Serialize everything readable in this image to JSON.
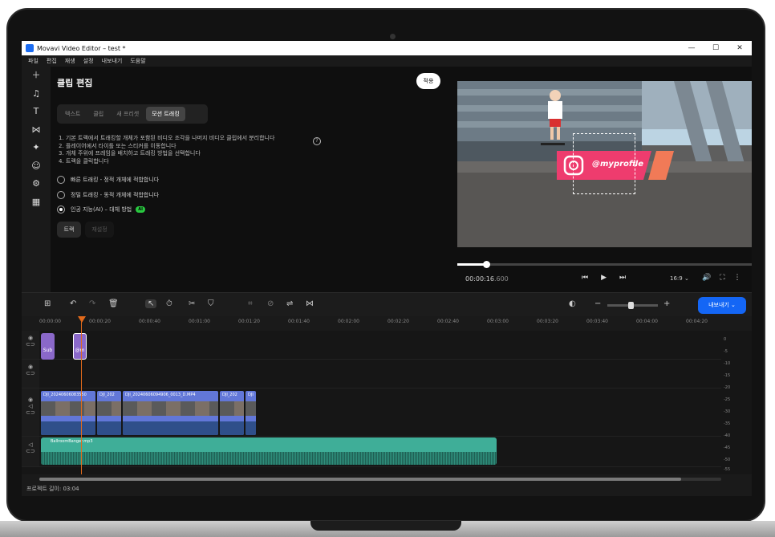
{
  "window": {
    "title": "Movavi Video Editor – test *",
    "controls": [
      "—",
      "☐",
      "✕"
    ]
  },
  "menu": [
    "파일",
    "편집",
    "재생",
    "설정",
    "내보내기",
    "도움말"
  ],
  "left_tools": [
    "plus-icon",
    "music-note-icon",
    "text-icon",
    "transition-icon",
    "effects-icon",
    "sticker-icon",
    "plugin-icon",
    "more-icon"
  ],
  "panel": {
    "title": "클립 편집",
    "apply": "적용",
    "tabs": [
      "텍스트",
      "클립",
      "새 프리셋",
      "모션 트래킹"
    ],
    "active_tab": 3,
    "steps": [
      "1. 기본 트랙에서 트래킹할 개체가 포함된 비디오 조각을 나머지 비디오 클립에서 분리합니다",
      "2. 플레이어에서 타이틀 또는 스티커를 이동합니다",
      "3. 개체 주위에 프레임을 배치하고 트래킹 방법을 선택합니다",
      "4. 트랙을 클릭합니다"
    ],
    "help": "?",
    "options": [
      {
        "label": "빠른 트래킹 - 정적 개체에 적합합니다",
        "selected": false
      },
      {
        "label": "정밀 트래킹 - 동적 개체에 적합합니다",
        "selected": false
      },
      {
        "label": "인공 지능(AI) – 대체 방법",
        "selected": true,
        "badge": "AI"
      }
    ],
    "track_button": "트랙",
    "reset_button": "재설정"
  },
  "preview": {
    "overlay_text": "@myprofile",
    "timecode": "00:00:16",
    "timecode_ms": ".600",
    "progress": 0.1,
    "aspect": "16:9",
    "aspect_arrow": "⌄",
    "controls": [
      "⏮",
      "▶",
      "⏭"
    ],
    "icons": [
      "🔊",
      "⛶",
      "⋮"
    ]
  },
  "toolbar": {
    "export": "내보내기 ⌄",
    "zoom_minus": "−",
    "zoom_plus": "+",
    "zoom_level": 0.45
  },
  "ruler": [
    "00:00:00",
    "00:00:20",
    "00:00:40",
    "00:01:00",
    "00:01:20",
    "00:01:40",
    "00:02:00",
    "00:02:20",
    "00:02:40",
    "00:03:00",
    "00:03:20",
    "00:03:40",
    "00:04:00",
    "00:04:20"
  ],
  "timeline": {
    "sticker_clips": [
      "Sub",
      "@m"
    ],
    "video_clips": [
      "DJI_20240606083550",
      "DJI_202",
      "DJI_20240606094906_0013_D.MP4",
      "DJI_202",
      "DJI"
    ],
    "audio_clip": "BallroomBanger.mp3",
    "db_labels": [
      "0",
      "-5",
      "-10",
      "-15",
      "-20",
      "-25",
      "-30",
      "-35",
      "-40",
      "-45",
      "-50",
      "-55"
    ]
  },
  "status": "프로젝트 길이: 03:04",
  "colors": {
    "accent": "#1466f5",
    "video_clip": "#6277d8",
    "audio_clip": "#3fae98",
    "sticker_clip": "#8a68c9",
    "playhead": "#e26a1b",
    "ai_badge": "#29c940"
  }
}
